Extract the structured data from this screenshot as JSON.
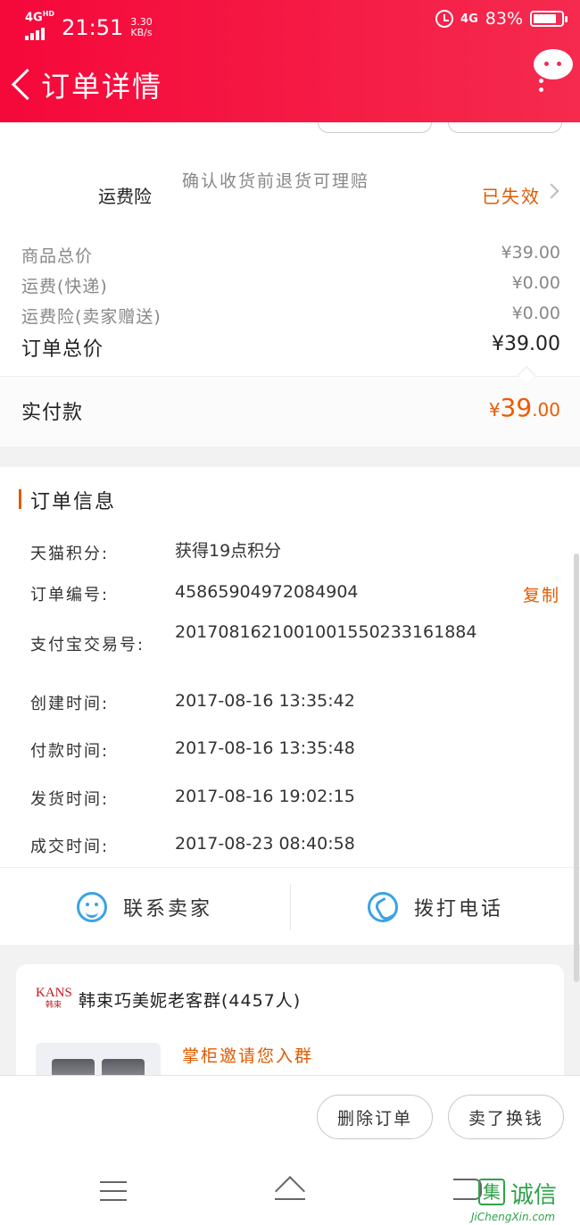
{
  "status_bar": {
    "network": "4G",
    "network_sup": "HD",
    "time": "21:51",
    "speed_value": "3.30",
    "speed_unit": "KB/s",
    "network_right": "4G",
    "battery": "83%"
  },
  "header": {
    "title": "订单详情"
  },
  "insurance": {
    "label": "运费险",
    "description": "确认收货前退货可理赔",
    "status": "已失效"
  },
  "prices": [
    {
      "label": "商品总价",
      "value": "¥39.00"
    },
    {
      "label": "运费(快递)",
      "value": "¥0.00"
    },
    {
      "label": "运费险(卖家赠送)",
      "value": "¥0.00"
    }
  ],
  "total": {
    "label": "订单总价",
    "value": "¥39.00"
  },
  "paid": {
    "label": "实付款",
    "currency": "¥",
    "integer": "39",
    "decimal": ".00"
  },
  "order_info": {
    "title": "订单信息",
    "rows": [
      {
        "label": "天猫积分:",
        "value": "获得19点积分"
      },
      {
        "label": "订单编号:",
        "value": "45865904972084904"
      },
      {
        "label": "支付宝交易号:",
        "value": "2017081621001001550233161884"
      },
      {
        "label": "创建时间:",
        "value": "2017-08-16 13:35:42"
      },
      {
        "label": "付款时间:",
        "value": "2017-08-16 13:35:48"
      },
      {
        "label": "发货时间:",
        "value": "2017-08-16 19:02:15"
      },
      {
        "label": "成交时间:",
        "value": "2017-08-23 08:40:58"
      }
    ],
    "copy_label": "复制"
  },
  "contact": {
    "seller_label": "联系卖家",
    "call_label": "拨打电话"
  },
  "group": {
    "logo_text": "KANS",
    "logo_sub": "韩束",
    "name": "韩束巧美妮老客群(4457人)",
    "invite": "掌柜邀请您入群"
  },
  "bottom": {
    "delete_label": "删除订单",
    "sell_label": "卖了换钱"
  },
  "watermark": {
    "box_char": "集",
    "text": "诚信",
    "url": "JiChengXin.com"
  },
  "colors": {
    "header": "#f5083a",
    "accent_orange": "#e05a00",
    "icon_blue": "#3aa3e3"
  }
}
